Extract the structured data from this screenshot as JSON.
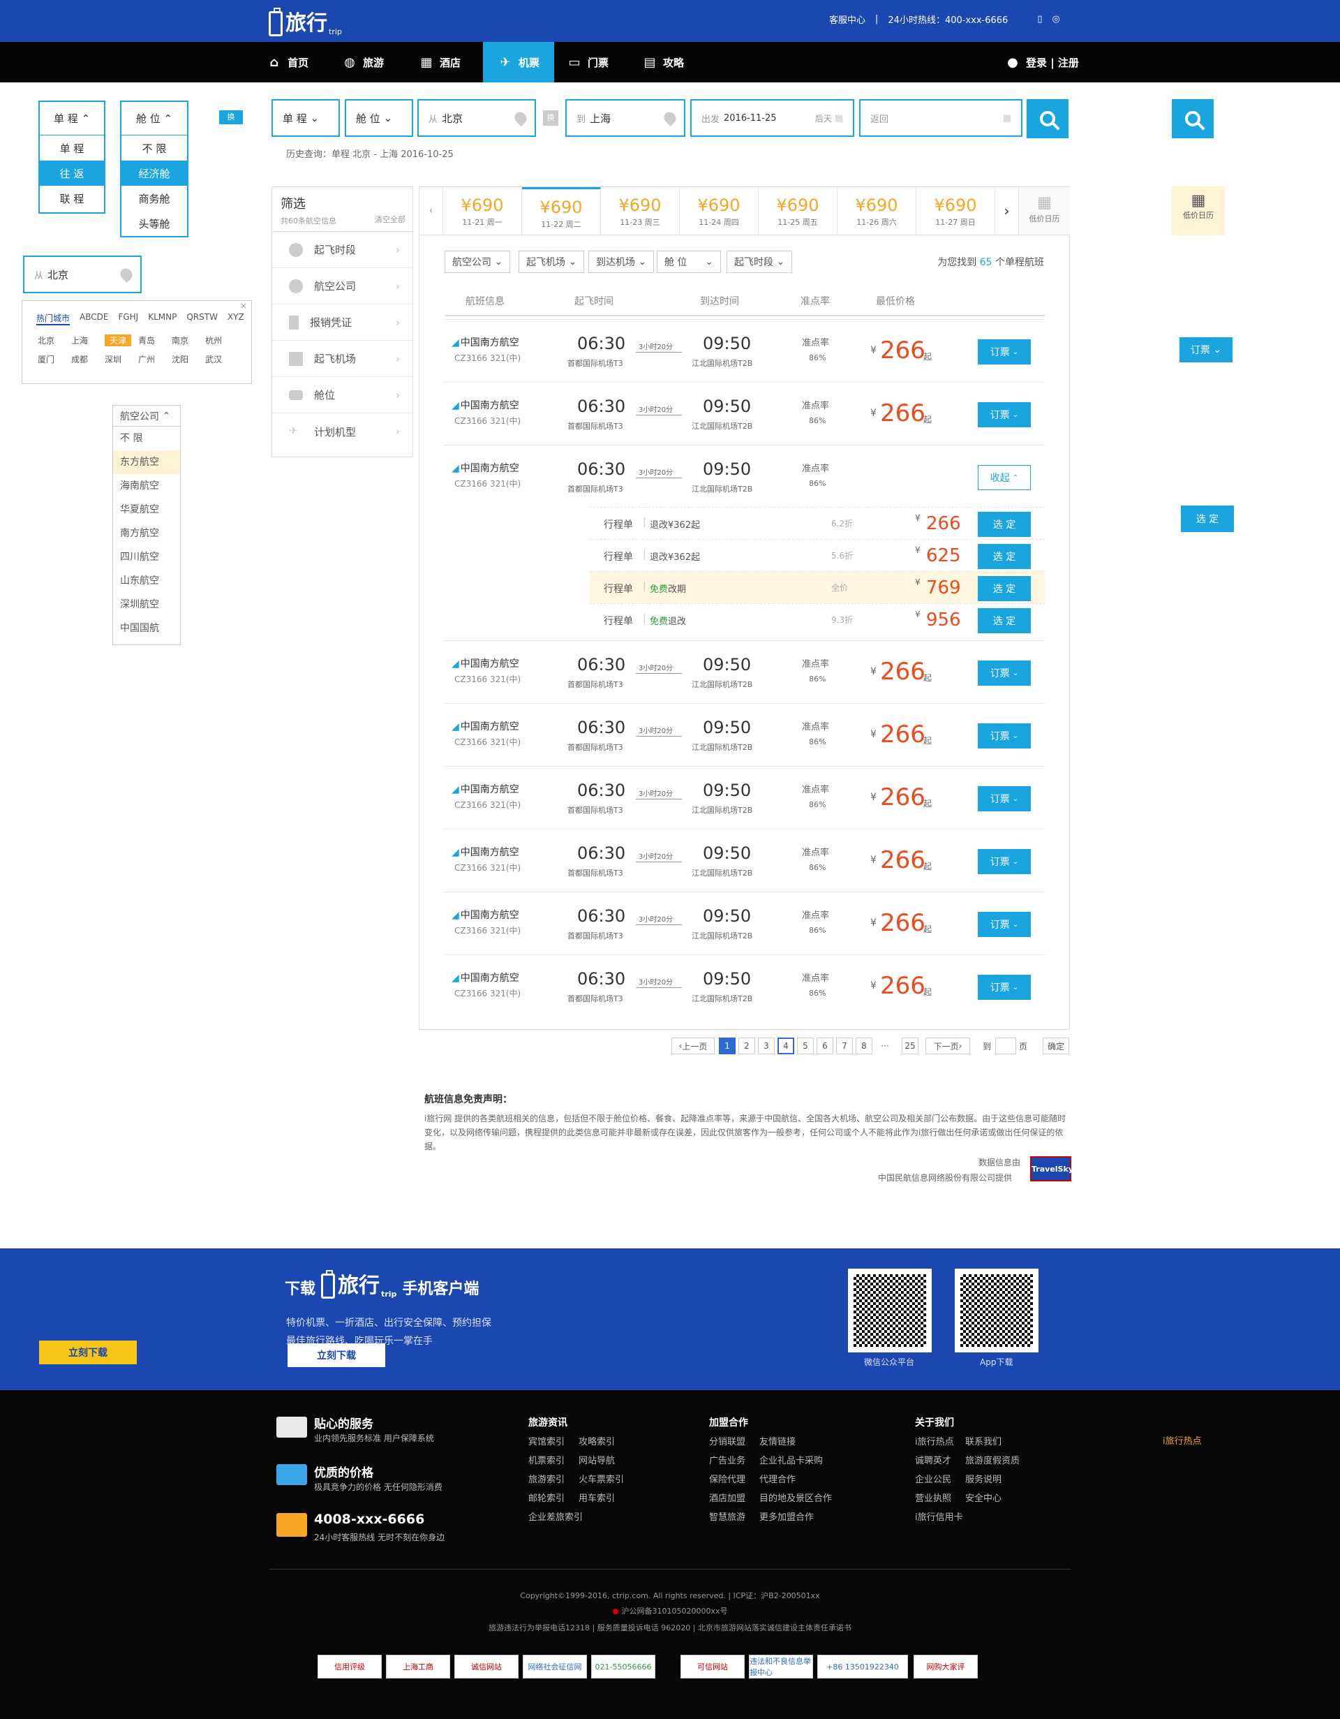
{
  "header": {
    "logo_main": "旅行",
    "logo_sub": "trip",
    "service": "客服中心",
    "sep": "|",
    "hotline": "24小时热线：400-xxx-6666"
  },
  "nav": {
    "items": [
      "首页",
      "旅游",
      "酒店",
      "机票",
      "门票",
      "攻略"
    ],
    "login": "登录 | 注册"
  },
  "dropdown_trip": {
    "head": "单 程",
    "options": [
      "单 程",
      "往 返",
      "联 程"
    ],
    "selected": "往 返"
  },
  "dropdown_cabin": {
    "head": "舱 位",
    "options": [
      "不 限",
      "经济舱",
      "商务舱",
      "头等舱"
    ],
    "selected": "经济舱"
  },
  "swap_label": "换",
  "city_picker": {
    "prefix": "从",
    "value": "北京",
    "tabs": [
      "热门城市",
      "ABCDE",
      "FGHJ",
      "KLMNP",
      "QRSTW",
      "XYZ"
    ],
    "cities": [
      "北京",
      "上海",
      "天津",
      "青岛",
      "南京",
      "杭州",
      "厦门",
      "成都",
      "深圳",
      "广州",
      "沈阳",
      "武汉"
    ],
    "highlight": "天津",
    "close": "×"
  },
  "airline_dd": {
    "head": "航空公司",
    "options": [
      "不 限",
      "东方航空",
      "海南航空",
      "华夏航空",
      "南方航空",
      "四川航空",
      "山东航空",
      "深圳航空",
      "中国国航"
    ],
    "highlight": "东方航空"
  },
  "search": {
    "trip": "单 程",
    "cabin": "舱 位",
    "from_prefix": "从",
    "from": "北京",
    "to_prefix": "到",
    "to": "上海",
    "depart_prefix": "出发",
    "depart": "2016-11-25",
    "depart_suffix": "后天",
    "return_placeholder": "返回",
    "history": "历史查询：单程 北京 - 上海 2016-10-25"
  },
  "filter": {
    "title": "筛选",
    "count": "共60条航空信息",
    "clear": "清空全部",
    "items": [
      "起飞时段",
      "航空公司",
      "报销凭证",
      "起飞机场",
      "舱位",
      "计划机型"
    ]
  },
  "dates": [
    {
      "price": "¥690",
      "date": "11-21 周一"
    },
    {
      "price": "¥690",
      "date": "11-22 周二"
    },
    {
      "price": "¥690",
      "date": "11-23 周三"
    },
    {
      "price": "¥690",
      "date": "11-24 周四"
    },
    {
      "price": "¥690",
      "date": "11-25 周五"
    },
    {
      "price": "¥690",
      "date": "11-26 周六"
    },
    {
      "price": "¥690",
      "date": "11-27 周日"
    }
  ],
  "low_calendar": "低价日历",
  "filters_row": [
    "航空公司",
    "起飞机场",
    "到达机场",
    "舱 位",
    "起飞时段"
  ],
  "found": {
    "pre": "为您找到",
    "num": "65",
    "post": "个单程航班"
  },
  "columns": [
    "航班信息",
    "起飞时间",
    "到达时间",
    "准点率",
    "最低价格"
  ],
  "flight": {
    "airline": "中国南方航空",
    "code": "CZ3166  321(中)",
    "dep": "06:30",
    "dep_ap": "首都国际机场T3",
    "dur": "3小时20分",
    "arr": "09:50",
    "arr_ap": "江北国际机场T2B",
    "rate_label": "准点率",
    "rate": "86%",
    "cur": "¥",
    "price": "266",
    "qi": "起",
    "book": "订票",
    "collapse": "收起"
  },
  "subrows": [
    {
      "type": "行程单",
      "cond_pre": "退改¥362起",
      "cond_green": "",
      "cond_post": "",
      "disc": "6.2折",
      "price": "266"
    },
    {
      "type": "行程单",
      "cond_pre": "退改¥362起",
      "cond_green": "",
      "cond_post": "",
      "disc": "5.6折",
      "price": "625"
    },
    {
      "type": "行程单",
      "cond_pre": "",
      "cond_green": "免费",
      "cond_post": "改期",
      "disc": "全价",
      "price": "769"
    },
    {
      "type": "行程单",
      "cond_pre": "",
      "cond_green": "免费",
      "cond_post": "退改",
      "disc": "9.3折",
      "price": "956"
    }
  ],
  "select_label": "选 定",
  "pager": {
    "prev": "上一页",
    "pages": [
      "1",
      "2",
      "3",
      "4",
      "5",
      "6",
      "7",
      "8"
    ],
    "dots": "···",
    "last": "25",
    "next": "下一页",
    "goto": "到",
    "page": "页",
    "ok": "确定"
  },
  "disclaimer": {
    "title": "航班信息免责声明：",
    "text": "i旅行网 提供的各类航班相关的信息，包括但不限于舱位价格、餐食、起降准点率等，来源于中国航信、全国各大机场、航空公司及相关部门公布数据。由于这些信息可能随时变化，以及网络传输问题，携程提供的此类信息可能并非最新或存在误差，因此仅供旅客作为一般参考，任何公司或个人不能将此作为i旅行做出任何承诺或做出任何保证的依据。",
    "src1": "数据信息由",
    "src2": "中国民航信息网络股份有限公司提供",
    "logo": "TravelSky"
  },
  "app": {
    "pre": "下载",
    "post": "手机客户端",
    "line1": "特价机票、一折酒店、出行安全保障、预约担保",
    "line2": "最佳旅行路线、吃喝玩乐一掌在手",
    "btn": "立刻下载",
    "qr1": "微信公众平台",
    "qr2": "App下载"
  },
  "features": [
    {
      "title": "贴心的服务",
      "desc": "业内领先服务标准 用户保障系统"
    },
    {
      "title": "优质的价格",
      "desc": "极具竞争力的价格 无任何隐形消费"
    },
    {
      "title": "4008-xxx-6666",
      "desc": "24小时客服热线 无时不刻在你身边"
    }
  ],
  "fcols": [
    {
      "title": "旅游资讯",
      "links": [
        "宾馆索引",
        "攻略索引",
        "机票索引",
        "网站导航",
        "旅游索引",
        "火车票索引",
        "邮轮索引",
        "用车索引",
        "企业差旅索引"
      ]
    },
    {
      "title": "加盟合作",
      "links": [
        "分销联盟",
        "友情链接",
        "广告业务",
        "企业礼品卡采购",
        "保险代理",
        "代理合作",
        "酒店加盟",
        "目的地及景区合作",
        "智慧旅游",
        "更多加盟合作"
      ]
    },
    {
      "title": "关于我们",
      "links": [
        "i旅行热点",
        "联系我们",
        "诚聘英才",
        "旅游度假资质",
        "企业公民",
        "服务说明",
        "营业执照",
        "安全中心",
        "i旅行信用卡"
      ]
    }
  ],
  "side_hot": "i旅行热点",
  "copyright": [
    "Copyright©1999-2016, ctrip.com. All rights reserved. | ICP证：沪B2-200501xx",
    "沪公网备310105020000xx号",
    "旅游违法行为举报电话12318 | 服务质量投诉电话 962020 | 北京市旅游网站落实诚信建设主体责任承诺书"
  ],
  "badges": [
    "信用评级",
    "上海工商",
    "诚信网站",
    "网络社会征信网",
    "021-55056666",
    "可信网站",
    "违法和不良信息举报中心",
    "+86 13501922340",
    "网购大家评"
  ],
  "colors": {
    "brand": "#1a47b0",
    "accent": "#1aa5e0",
    "price": "#f04a1b",
    "gold": "#f5a623"
  }
}
